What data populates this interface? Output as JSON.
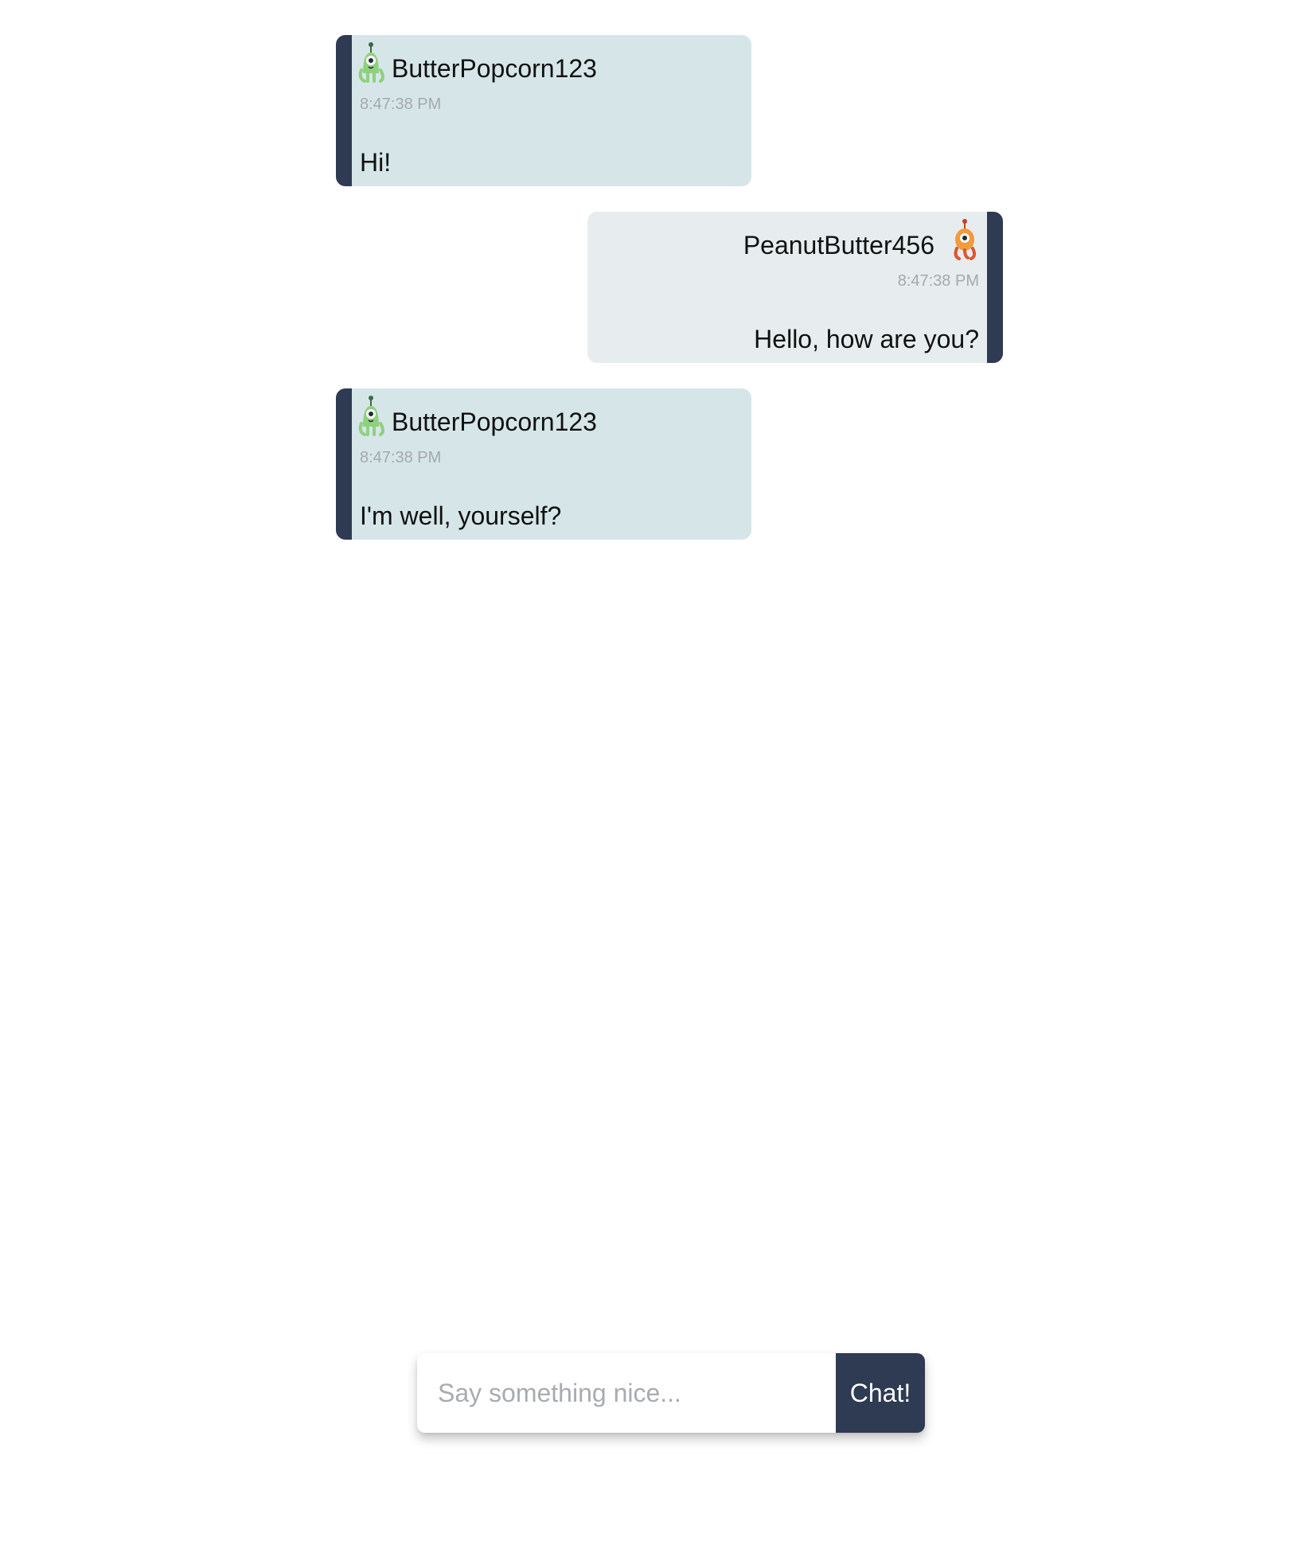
{
  "messages": [
    {
      "side": "left",
      "username": "ButterPopcorn123",
      "avatar_icon": "green-alien-icon",
      "time": "8:47:38 PM",
      "text": "Hi!"
    },
    {
      "side": "right",
      "username": "PeanutButter456",
      "avatar_icon": "orange-alien-icon",
      "time": "8:47:38 PM",
      "text": "Hello, how are you?"
    },
    {
      "side": "left",
      "username": "ButterPopcorn123",
      "avatar_icon": "green-alien-icon",
      "time": "8:47:38 PM",
      "text": "I'm well, yourself?"
    }
  ],
  "composer": {
    "placeholder": "Say something nice...",
    "value": "",
    "button_label": "Chat!"
  },
  "colors": {
    "accent": "#2f3a53",
    "bubble_left": "#d6e6e8",
    "bubble_right": "#e7edee",
    "timestamp": "#a4a9ad"
  }
}
